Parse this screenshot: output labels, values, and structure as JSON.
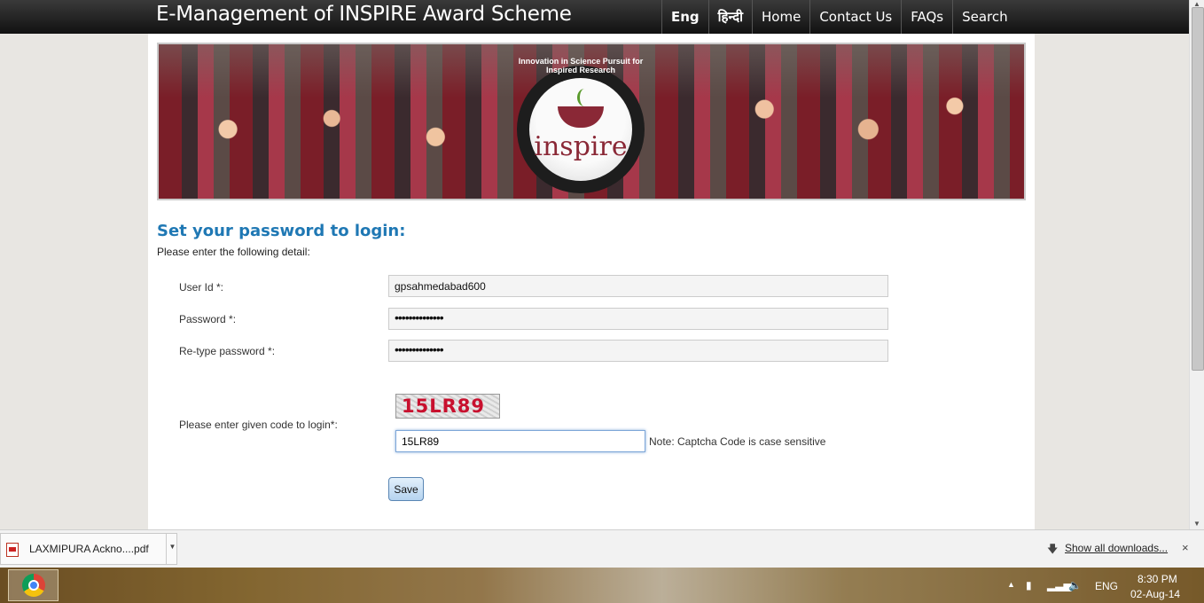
{
  "header": {
    "site_title": "E-Management of INSPIRE Award Scheme",
    "nav": [
      {
        "label": "Eng"
      },
      {
        "label": "हिन्दी"
      },
      {
        "label": "Home"
      },
      {
        "label": "Contact Us"
      },
      {
        "label": "FAQs"
      },
      {
        "label": "Search"
      }
    ]
  },
  "banner": {
    "logo_word": "inspire",
    "logo_ring_text": "Innovation in Science Pursuit for Inspired Research"
  },
  "form": {
    "title": "Set your password to login:",
    "subtitle": "Please enter the following detail:",
    "user_id_label": "User Id *:",
    "user_id_value": "gpsahmedabad600",
    "password_label": "Password *:",
    "password_value": "••••••••••••••",
    "retype_label": "Re-type password *:",
    "retype_value": "••••••••••••••",
    "captcha_label": "Please enter given code to login*:",
    "captcha_image_text": "15LR89",
    "captcha_input_value": "15LR89",
    "captcha_note": "Note: Captcha Code is case sensitive",
    "save_label": "Save"
  },
  "downloads": {
    "file_name": "LAXMIPURA Ackno....pdf",
    "show_all": "Show all downloads...",
    "close": "×"
  },
  "taskbar": {
    "language": "ENG",
    "time": "8:30 PM",
    "date": "02-Aug-14"
  }
}
